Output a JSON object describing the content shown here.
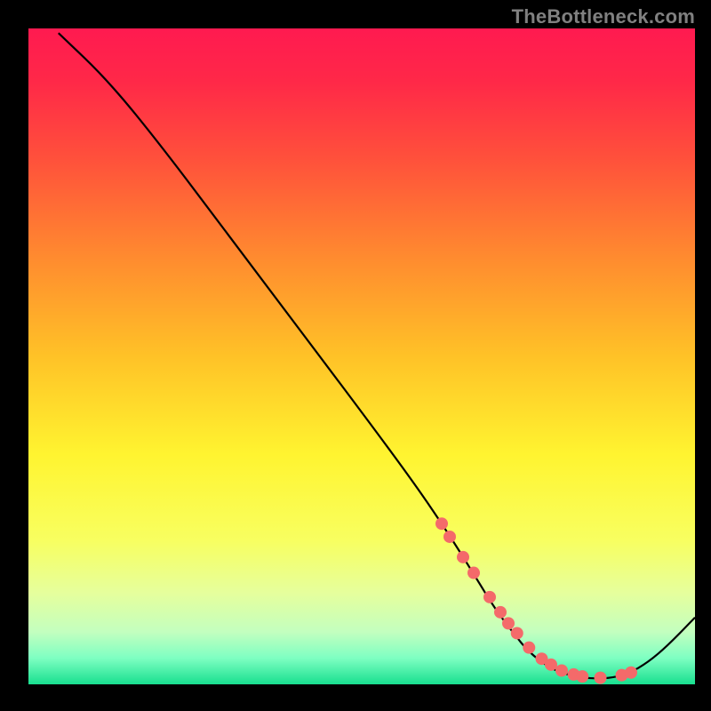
{
  "watermark": "TheBottleneck.com",
  "chart_data": {
    "type": "line",
    "title": "",
    "xlabel": "",
    "ylabel": "",
    "xlim": [
      0,
      100
    ],
    "ylim": [
      0,
      100
    ],
    "grid": false,
    "legend": false,
    "annotations": [],
    "gradient_stops": [
      {
        "offset": 0.0,
        "color": "#ff1a50"
      },
      {
        "offset": 0.08,
        "color": "#ff2848"
      },
      {
        "offset": 0.2,
        "color": "#ff513b"
      },
      {
        "offset": 0.35,
        "color": "#ff8b2f"
      },
      {
        "offset": 0.5,
        "color": "#ffc227"
      },
      {
        "offset": 0.65,
        "color": "#fff430"
      },
      {
        "offset": 0.78,
        "color": "#f8ff60"
      },
      {
        "offset": 0.86,
        "color": "#e6ff9c"
      },
      {
        "offset": 0.92,
        "color": "#c3ffbf"
      },
      {
        "offset": 0.96,
        "color": "#7effc2"
      },
      {
        "offset": 1.0,
        "color": "#18df8f"
      }
    ],
    "curve": {
      "x": [
        4.5,
        12,
        20,
        30,
        40,
        50,
        58,
        63,
        67,
        70,
        73,
        75,
        78,
        81,
        84,
        87,
        90,
        93,
        96,
        100
      ],
      "y": [
        99.3,
        92,
        82,
        68.5,
        55,
        41.5,
        30.5,
        23,
        16.5,
        11.5,
        7.5,
        5.0,
        2.6,
        1.4,
        0.9,
        0.9,
        1.6,
        3.4,
        6.0,
        10.2
      ]
    },
    "markers": {
      "x": [
        62.0,
        63.2,
        65.2,
        66.8,
        69.2,
        70.8,
        72.0,
        73.3,
        75.1,
        77.0,
        78.4,
        80.0,
        81.8,
        83.1,
        85.8,
        89.0,
        90.4
      ],
      "y": [
        24.5,
        22.5,
        19.4,
        17.0,
        13.3,
        11.0,
        9.3,
        7.8,
        5.6,
        3.9,
        3.0,
        2.1,
        1.5,
        1.2,
        1.0,
        1.4,
        1.8
      ],
      "color": "#f46a6a",
      "radius": 7
    }
  }
}
